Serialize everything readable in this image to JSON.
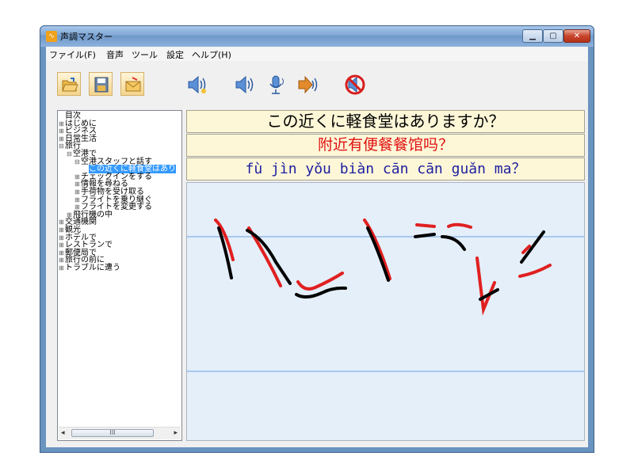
{
  "window": {
    "title": "声調マスター",
    "app_icon": "wave-icon",
    "controls": [
      "minimize",
      "maximize",
      "close"
    ]
  },
  "menu": [
    "ファイル(F)",
    "音声",
    "ツール",
    "設定",
    "ヘルプ(H)"
  ],
  "toolbar": {
    "buttons": [
      "open-folder",
      "save",
      "email",
      "play",
      "play",
      "record",
      "compare",
      "stop"
    ]
  },
  "tree": [
    {
      "label": "目次",
      "exp": "",
      "level": 0
    },
    {
      "label": "はじめに",
      "exp": "⊞",
      "level": 0
    },
    {
      "label": "ビジネス",
      "exp": "⊞",
      "level": 0
    },
    {
      "label": "日常生活",
      "exp": "⊞",
      "level": 0
    },
    {
      "label": "旅行",
      "exp": "⊟",
      "level": 0
    },
    {
      "label": "空港で",
      "exp": "⊟",
      "level": 1
    },
    {
      "label": "空港スタッフと話す",
      "exp": "⊟",
      "level": 2
    },
    {
      "label": "この近くに軽食堂はあり",
      "exp": "",
      "level": 3,
      "selected": true
    },
    {
      "label": "チェックインをする",
      "exp": "⊞",
      "level": 2
    },
    {
      "label": "情報を尋ねる",
      "exp": "⊞",
      "level": 2
    },
    {
      "label": "手荷物を受け取る",
      "exp": "⊞",
      "level": 2
    },
    {
      "label": "フライトを乗り継ぐ",
      "exp": "⊞",
      "level": 2
    },
    {
      "label": "フライトを変更する",
      "exp": "⊞",
      "level": 2
    },
    {
      "label": "飛行機の中",
      "exp": "⊞",
      "level": 1
    },
    {
      "label": "交通機関",
      "exp": "⊞",
      "level": 0
    },
    {
      "label": "観光",
      "exp": "⊞",
      "level": 0
    },
    {
      "label": "ホテルで",
      "exp": "⊞",
      "level": 0
    },
    {
      "label": "レストランで",
      "exp": "⊞",
      "level": 0
    },
    {
      "label": "郵便局で",
      "exp": "⊞",
      "level": 0
    },
    {
      "label": "旅行の前に",
      "exp": "⊞",
      "level": 0
    },
    {
      "label": "トラブルに遭う",
      "exp": "⊞",
      "level": 0
    }
  ],
  "scrollbar": {
    "left_arrow": "◂",
    "right_arrow": "▸",
    "thumb_grip": "III"
  },
  "sentence": {
    "japanese": "この近くに軽食堂はありますか？",
    "chinese": "附近有便餐餐馆吗？",
    "pinyin": "fù jìn yǒu biàn cān cān guǎn ma？"
  },
  "colors": {
    "reference_curve": "#e02020",
    "user_curve": "#000000",
    "canvas_bg": "#e4effa",
    "guide_line": "#a8c8ec"
  }
}
